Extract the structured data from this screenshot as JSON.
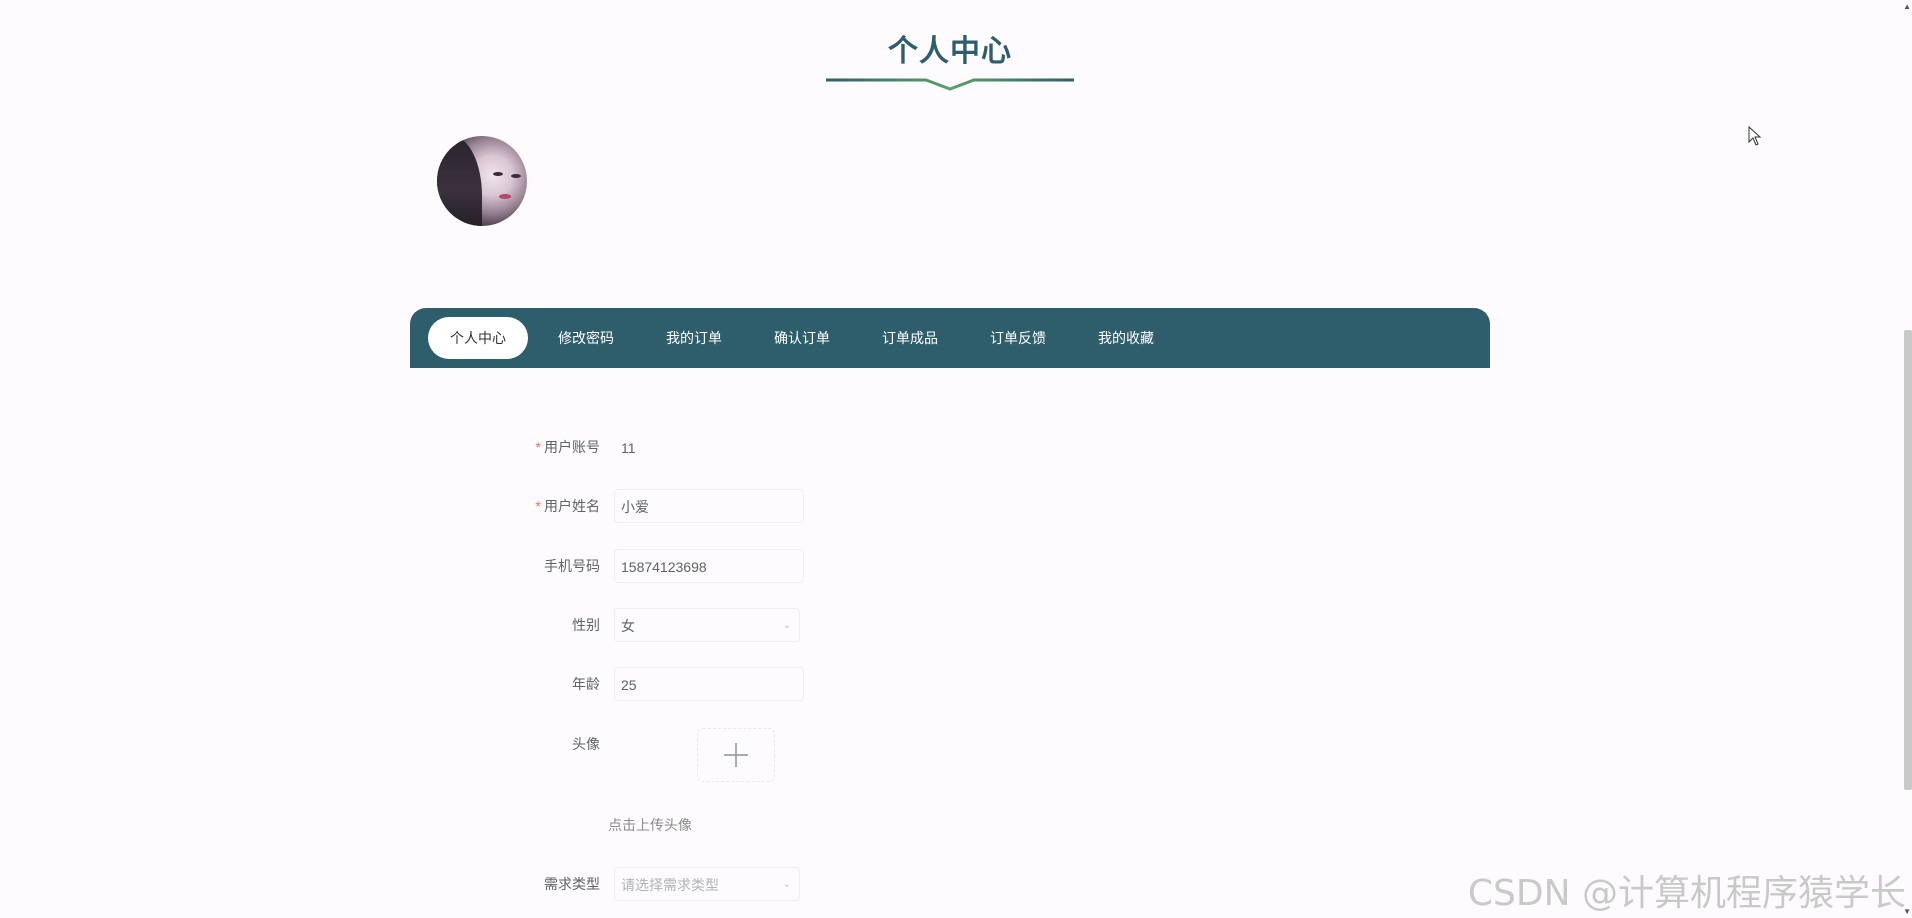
{
  "page": {
    "title": "个人中心"
  },
  "nav": {
    "items": [
      {
        "label": "个人中心",
        "active": true
      },
      {
        "label": "修改密码"
      },
      {
        "label": "我的订单"
      },
      {
        "label": "确认订单"
      },
      {
        "label": "订单成品"
      },
      {
        "label": "订单反馈"
      },
      {
        "label": "我的收藏"
      }
    ]
  },
  "form": {
    "account": {
      "label": "用户账号",
      "required": "*",
      "value": "11"
    },
    "name": {
      "label": "用户姓名",
      "required": "*",
      "value": "小爱"
    },
    "phone": {
      "label": "手机号码",
      "value": "15874123698"
    },
    "gender": {
      "label": "性别",
      "value": "女"
    },
    "age": {
      "label": "年龄",
      "value": "25"
    },
    "avatar": {
      "label": "头像",
      "upload_hint": "点击上传头像"
    },
    "demand_type": {
      "label": "需求类型",
      "placeholder": "请选择需求类型"
    }
  },
  "watermark": "CSDN @计算机程序猿学长",
  "colors": {
    "primary": "#2e5e6b",
    "accent": "#5aa26a",
    "required": "#f56c6c"
  }
}
